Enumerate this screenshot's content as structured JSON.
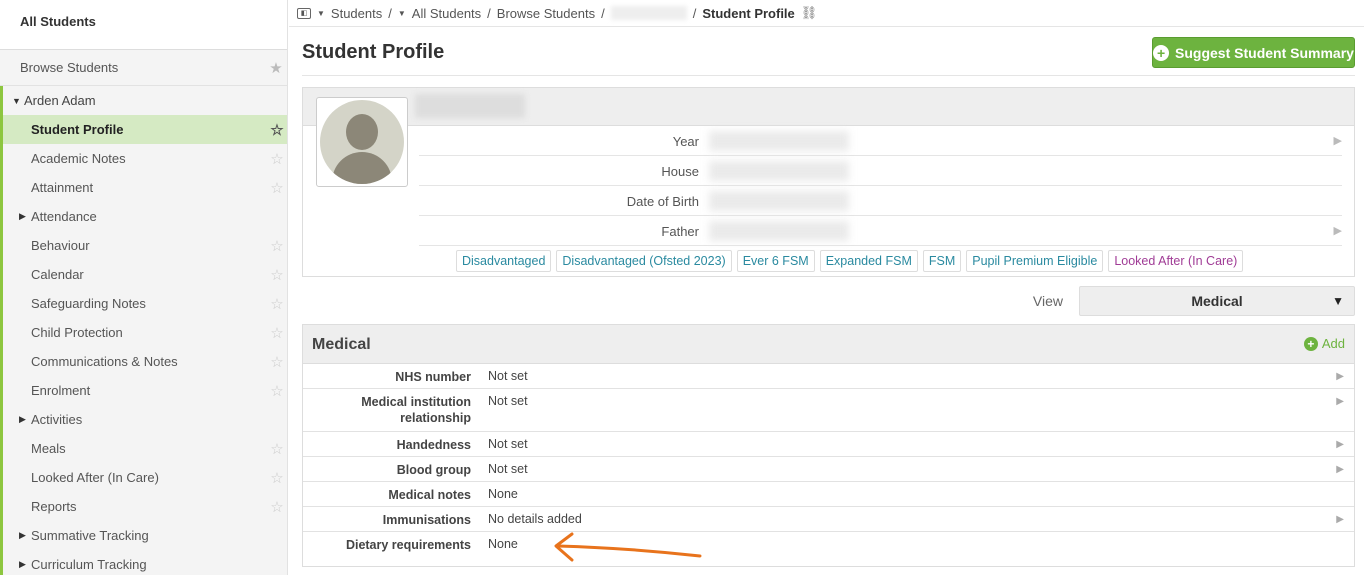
{
  "sidebar": {
    "header": "All Students",
    "browse": "Browse Students",
    "parent": "Arden Adam",
    "items": [
      {
        "label": "Student Profile",
        "active": true,
        "star": true
      },
      {
        "label": "Academic Notes",
        "star": true
      },
      {
        "label": "Attainment",
        "star": true
      },
      {
        "label": "Attendance",
        "expandable": true
      },
      {
        "label": "Behaviour",
        "star": true
      },
      {
        "label": "Calendar",
        "star": true
      },
      {
        "label": "Safeguarding Notes",
        "star": true
      },
      {
        "label": "Child Protection",
        "star": true
      },
      {
        "label": "Communications & Notes",
        "star": true
      },
      {
        "label": "Enrolment",
        "star": true
      },
      {
        "label": "Activities",
        "expandable": true
      },
      {
        "label": "Meals",
        "star": true
      },
      {
        "label": "Looked After (In Care)",
        "star": true
      },
      {
        "label": "Reports",
        "star": true
      },
      {
        "label": "Summative Tracking",
        "expandable": true
      },
      {
        "label": "Curriculum Tracking",
        "expandable": true
      }
    ]
  },
  "breadcrumb": {
    "students": "Students",
    "all_students": "All Students",
    "browse_students": "Browse Students",
    "current": "Student Profile"
  },
  "page": {
    "title": "Student Profile",
    "suggest_button": "Suggest Student Summary"
  },
  "profile": {
    "fields": [
      {
        "label": "Year",
        "has_arrow": true
      },
      {
        "label": "House",
        "has_arrow": false
      },
      {
        "label": "Date of Birth",
        "has_arrow": false
      },
      {
        "label": "Father",
        "has_arrow": true
      }
    ],
    "tags": [
      {
        "label": "Disadvantaged",
        "color": "#2a8aa0"
      },
      {
        "label": "Disadvantaged (Ofsted 2023)",
        "color": "#2a8aa0"
      },
      {
        "label": "Ever 6 FSM",
        "color": "#2a8aa0"
      },
      {
        "label": "Expanded FSM",
        "color": "#2a8aa0"
      },
      {
        "label": "FSM",
        "color": "#2a8aa0"
      },
      {
        "label": "Pupil Premium Eligible",
        "color": "#2a8aa0"
      },
      {
        "label": "Looked After (In Care)",
        "color": "#a03c96"
      }
    ]
  },
  "view": {
    "label": "View",
    "selected": "Medical"
  },
  "medical": {
    "title": "Medical",
    "add_label": "Add",
    "rows": [
      {
        "label": "NHS number",
        "value": "Not set",
        "has_arrow": true
      },
      {
        "label": "Medical institution relationship",
        "value": "Not set",
        "has_arrow": true
      },
      {
        "label": "Handedness",
        "value": "Not set",
        "has_arrow": true
      },
      {
        "label": "Blood group",
        "value": "Not set",
        "has_arrow": true
      },
      {
        "label": "Medical notes",
        "value": "None",
        "has_arrow": false
      },
      {
        "label": "Immunisations",
        "value": "No details added",
        "has_arrow": true
      },
      {
        "label": "Dietary requirements",
        "value": "None",
        "has_arrow": false
      }
    ]
  },
  "colors": {
    "accent_green": "#6db33f",
    "active_item_bg": "#d5eac3",
    "annotation_arrow": "#e8731c"
  }
}
